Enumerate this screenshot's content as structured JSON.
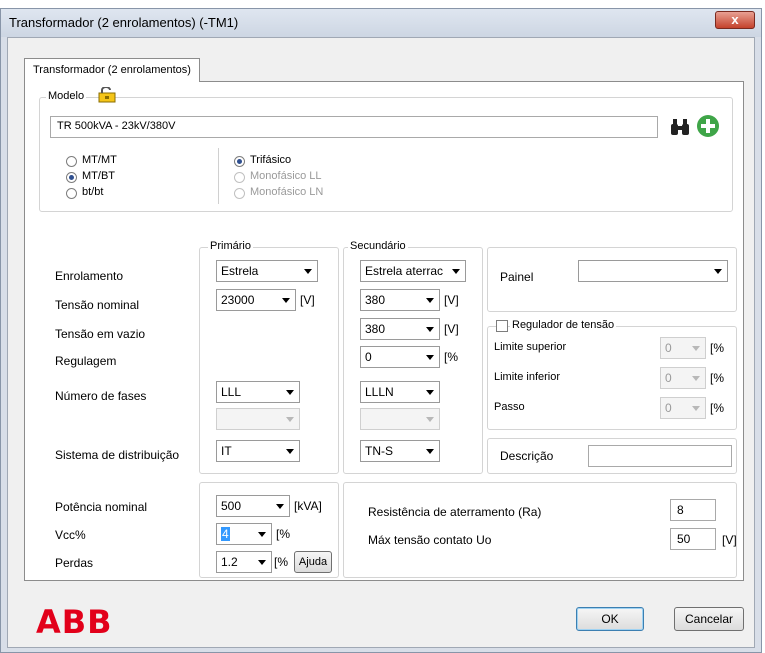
{
  "window": {
    "title": "Transformador (2 enrolamentos) (-TM1)",
    "close_glyph": "x"
  },
  "tab": {
    "label": "Transformador (2 enrolamentos)"
  },
  "model": {
    "group_label": "Modelo",
    "value": "TR 500kVA - 23kV/380V",
    "type_options": [
      {
        "label": "MT/MT",
        "selected": false
      },
      {
        "label": "MT/BT",
        "selected": true
      },
      {
        "label": "bt/bt",
        "selected": false
      }
    ],
    "phase_options": [
      {
        "label": "Trifásico",
        "selected": true,
        "enabled": true
      },
      {
        "label": "Monofásico LL",
        "selected": false,
        "enabled": false
      },
      {
        "label": "Monofásico LN",
        "selected": false,
        "enabled": false
      }
    ]
  },
  "windings": {
    "primario_label": "Primário",
    "secundario_label": "Secundário",
    "rows": {
      "enrolamento": "Enrolamento",
      "tensao_nominal": "Tensão nominal",
      "tensao_vazio": "Tensão em vazio",
      "regulagem": "Regulagem",
      "numero_fases": "Número de fases",
      "sistema_distribuicao": "Sistema de distribuição"
    },
    "primario": {
      "enrolamento": "Estrela",
      "tensao_nominal": "23000",
      "tensao_unit": "[V]",
      "numero_fases": "LLL",
      "sistema": "IT"
    },
    "secundario": {
      "enrolamento": "Estrela aterrac",
      "tensao_nominal": "380",
      "tensao_unit": "[V]",
      "tensao_vazio": "380",
      "tensao_vazio_unit": "[V]",
      "regulagem": "0",
      "regulagem_unit": "[%",
      "numero_fases": "LLLN",
      "sistema": "TN-S"
    }
  },
  "painel": {
    "label": "Painel",
    "value": ""
  },
  "regulador": {
    "label": "Regulador de tensão",
    "checked": false,
    "limite_superior_label": "Limite superior",
    "limite_superior": "0",
    "limite_inferior_label": "Limite inferior",
    "limite_inferior": "0",
    "passo_label": "Passo",
    "passo": "0",
    "unit": "[%"
  },
  "descricao": {
    "label": "Descrição",
    "value": ""
  },
  "power": {
    "potencia_label": "Potência nominal",
    "potencia": "500",
    "potencia_unit": "[kVA]",
    "vcc_label": "Vcc%",
    "vcc": "4",
    "vcc_unit": "[%",
    "perdas_label": "Perdas",
    "perdas": "1.2",
    "perdas_unit": "[%",
    "ajuda_label": "Ajuda"
  },
  "grounding": {
    "ra_label": "Resistência de aterramento (Ra)",
    "ra": "8",
    "uo_label": "Máx tensão contato Uo",
    "uo": "50",
    "uo_unit": "[V]"
  },
  "footer": {
    "brand": "ABB",
    "brand_color": "#e2001a",
    "ok_label": "OK",
    "cancel_label": "Cancelar"
  }
}
